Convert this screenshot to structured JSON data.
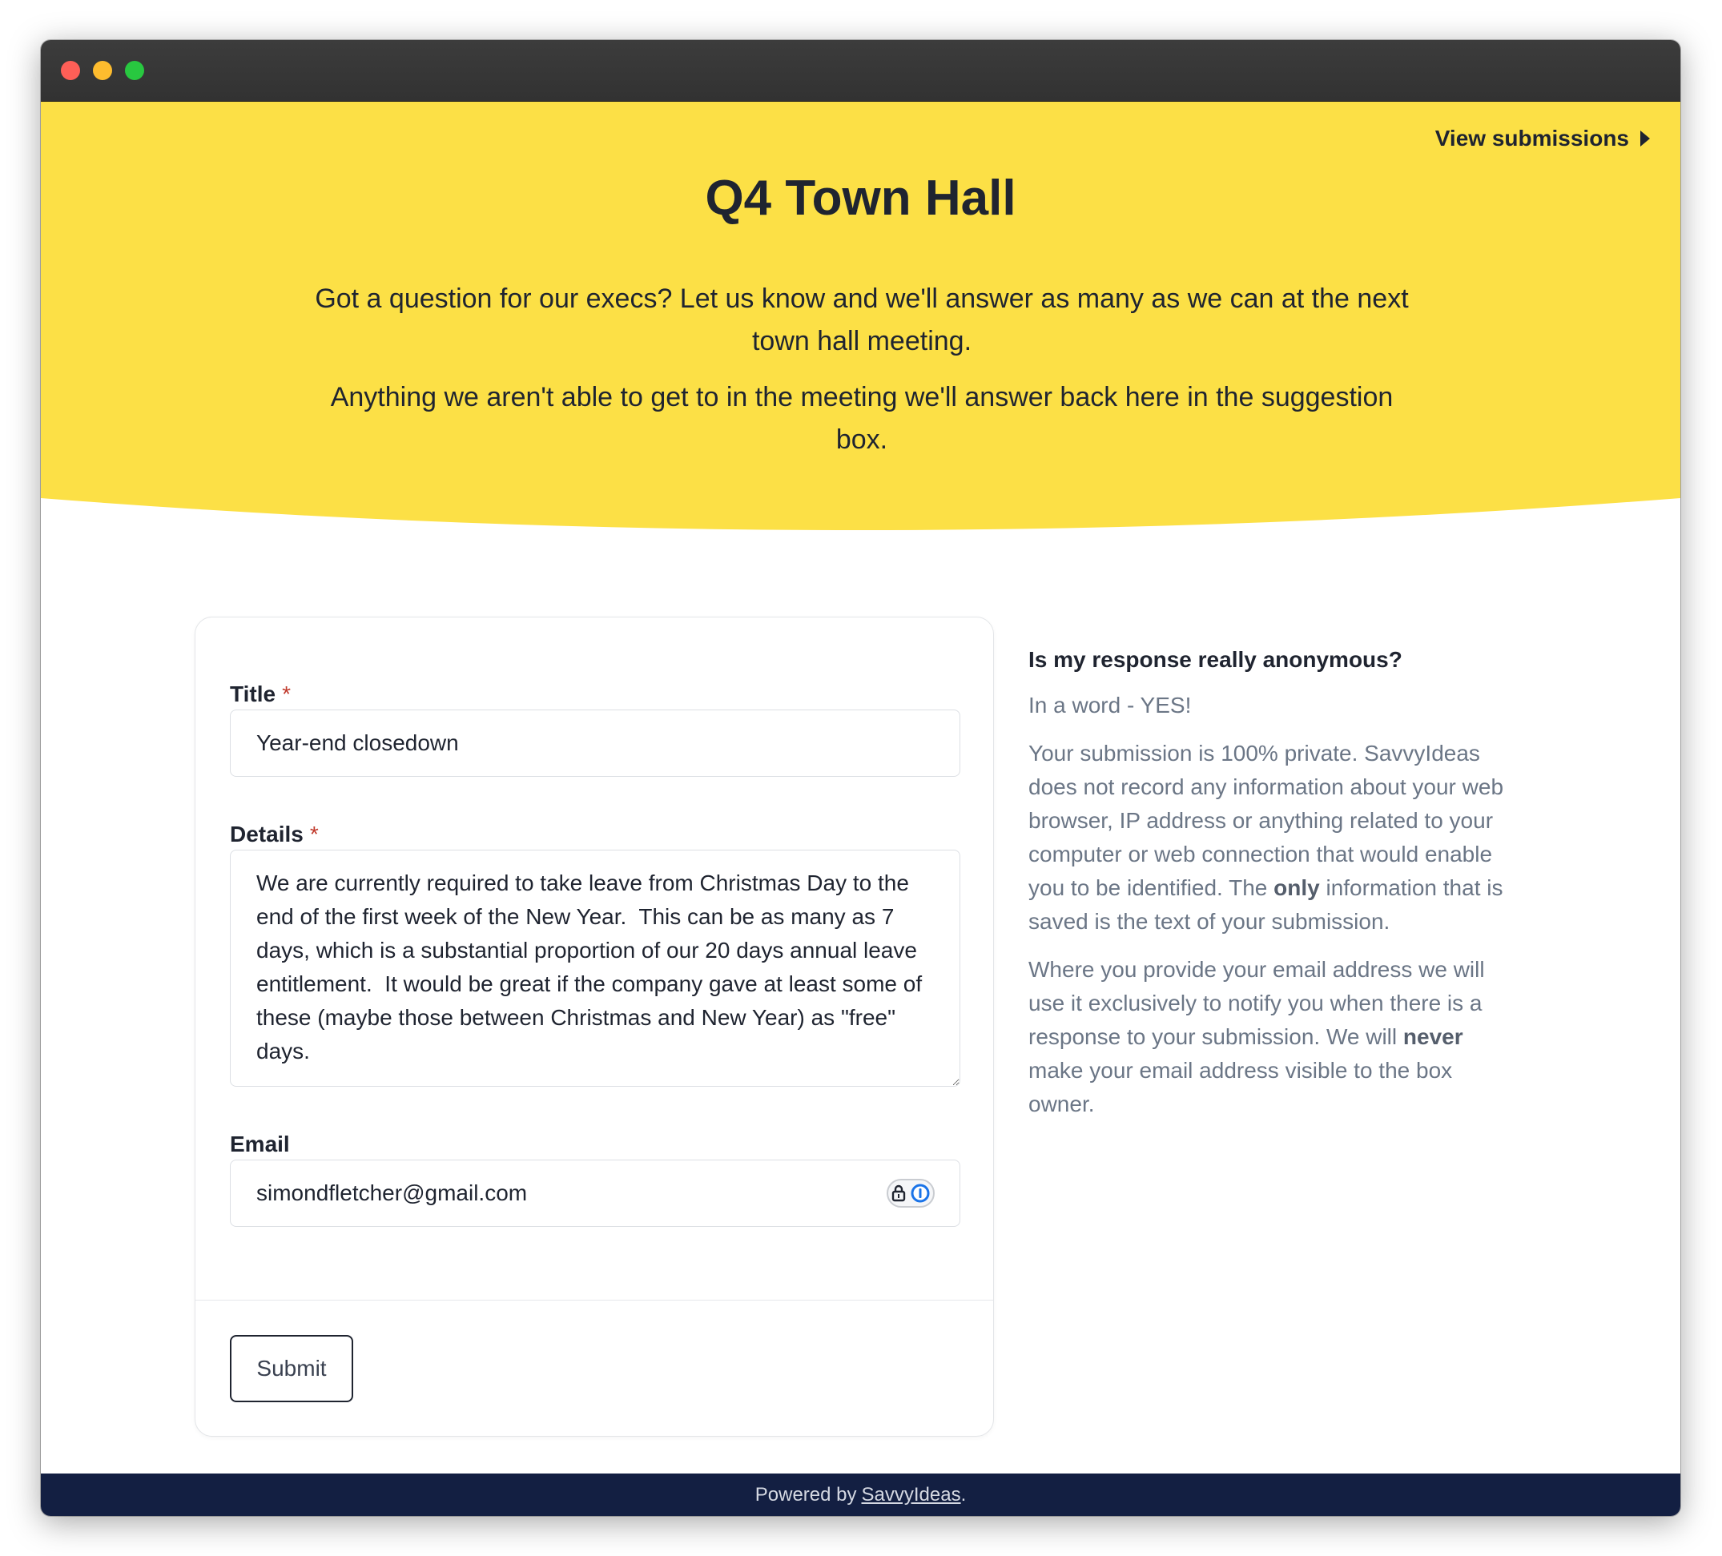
{
  "header": {
    "view_submissions_label": "View submissions",
    "title": "Q4 Town Hall",
    "intro_1": "Got a question for our execs? Let us know and we'll answer as many as we can at the next town hall meeting.",
    "intro_2": "Anything we aren't able to get to in the meeting we'll answer back here in the suggestion box."
  },
  "form": {
    "title_label": "Title",
    "title_value": "Year-end closedown",
    "details_label": "Details",
    "details_value": "We are currently required to take leave from Christmas Day to the end of the first week of the New Year.  This can be as many as 7 days, which is a substantial proportion of our 20 days annual leave entitlement.  It would be great if the company gave at least some of these (maybe those between Christmas and New Year) as \"free\" days.",
    "email_label": "Email",
    "email_value": "simondfletcher@gmail.com",
    "required_marker": "*",
    "submit_label": "Submit"
  },
  "aside": {
    "heading": "Is my response really anonymous?",
    "short_answer": "In a word - YES!",
    "p1_a": "Your submission is 100% private. SavvyIdeas does not record any information about your web browser, IP address or anything related to your computer or web connection that would enable you to be identified. The ",
    "p1_bold": "only",
    "p1_b": " information that is saved is the text of your submission.",
    "p2_a": "Where you provide your email address we will use it exclusively to notify you when there is a response to your submission. We will ",
    "p2_bold": "never",
    "p2_b": " make your email address visible to the box owner."
  },
  "footer": {
    "prefix": "Powered by",
    "link": "SavvyIdeas",
    "suffix": "."
  },
  "colors": {
    "hero_yellow": "#fce046",
    "footer_navy": "#131f42",
    "text_dark": "#1f2430",
    "text_muted": "#6b7686",
    "required_red": "#c0392b"
  }
}
